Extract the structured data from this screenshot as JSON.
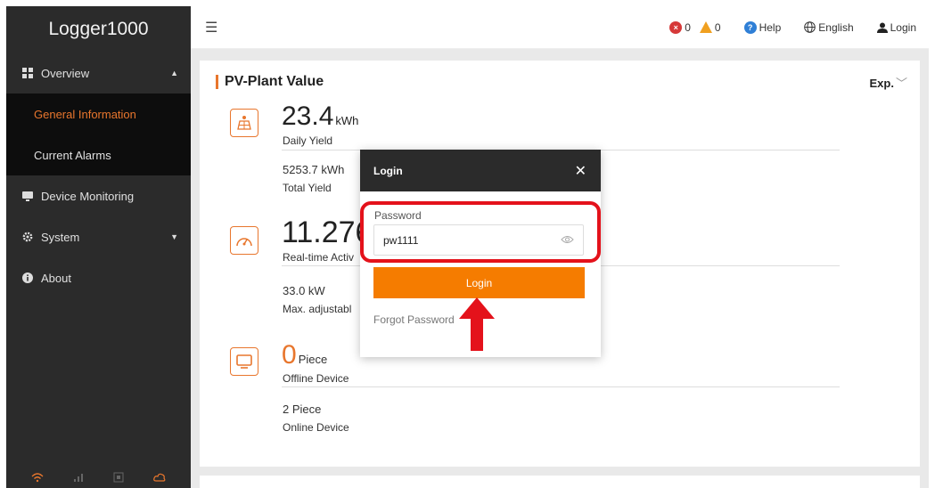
{
  "sidebar": {
    "brand": "Logger1000",
    "items": [
      {
        "label": "Overview",
        "icon": "grid-icon"
      },
      {
        "label": "General Information"
      },
      {
        "label": "Current Alarms"
      },
      {
        "label": "Device Monitoring",
        "icon": "monitor-icon"
      },
      {
        "label": "System",
        "icon": "gear-icon"
      },
      {
        "label": "About",
        "icon": "info-icon"
      }
    ]
  },
  "topbar": {
    "error_count": "0",
    "warning_count": "0",
    "help_label": "Help",
    "language_label": "English",
    "login_label": "Login"
  },
  "card": {
    "title": "PV-Plant Value",
    "export_label": "Exp.",
    "daily_yield_value": "23.4",
    "daily_yield_unit": "kWh",
    "daily_yield_label": "Daily Yield",
    "total_yield_value": "5253.7 kWh",
    "total_yield_label": "Total Yield",
    "realtime_value": "11.276",
    "realtime_label": "Real-time Activ",
    "max_adjustable_value": "33.0 kW",
    "max_adjustable_label": "Max. adjustabl",
    "offline_value": "0",
    "offline_unit": "Piece",
    "offline_label": "Offline Device",
    "online_value": "2 Piece",
    "online_label": "Online Device"
  },
  "modal": {
    "title": "Login",
    "password_label": "Password",
    "password_value": "pw1111",
    "login_button": "Login",
    "forgot_password": "Forgot Password"
  },
  "colors": {
    "accent": "#e8762d",
    "button": "#f57c00",
    "highlight": "#e4121b"
  }
}
